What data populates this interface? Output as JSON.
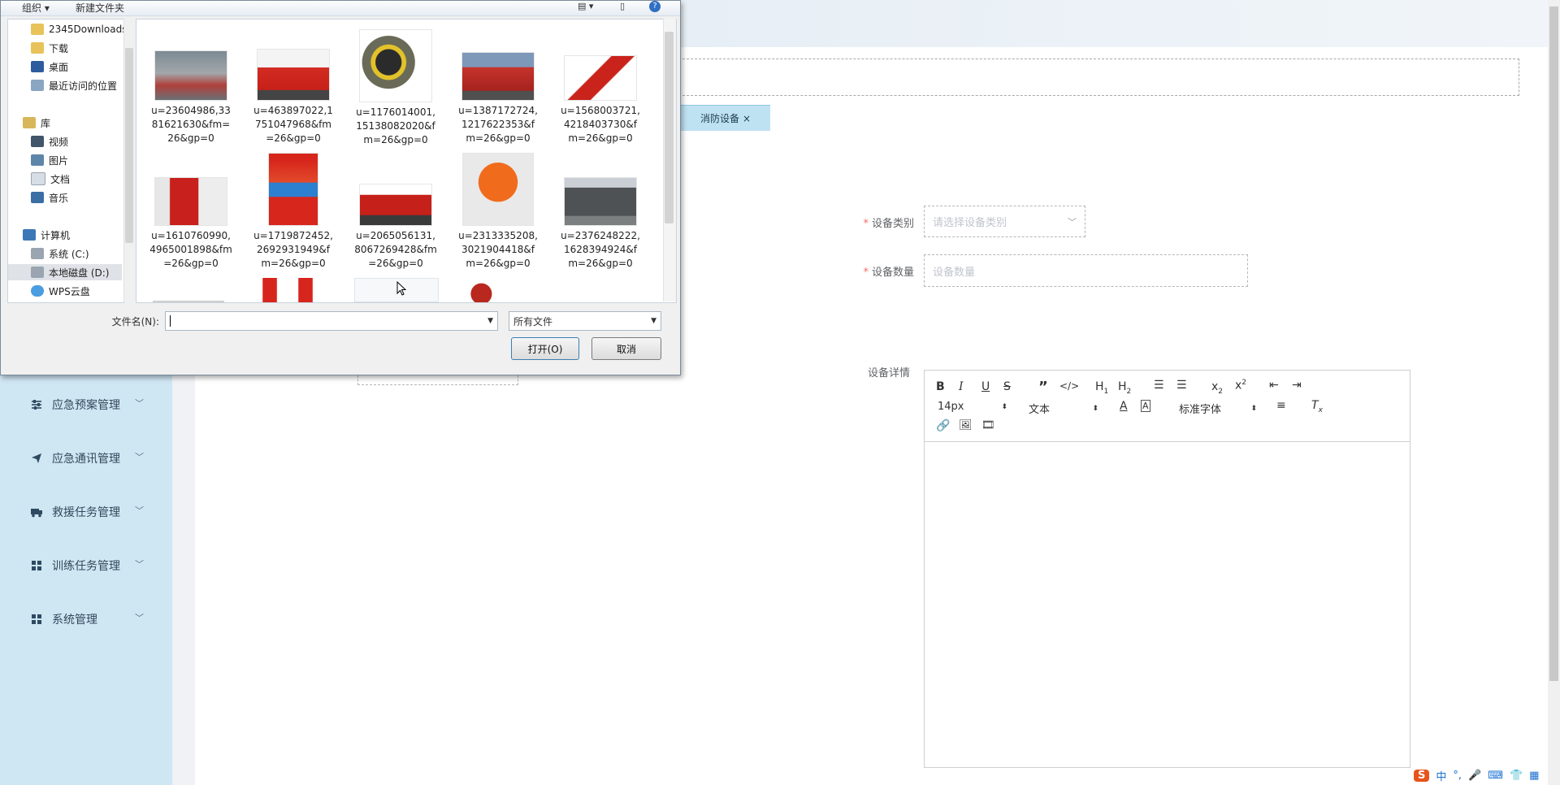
{
  "dialog": {
    "toolbar": {
      "organize_label": "组织 ▾",
      "new_folder_label": "新建文件夹"
    },
    "nav_items": [
      {
        "label": "2345Downloads",
        "icon": "folder-icon"
      },
      {
        "label": "下载",
        "icon": "download-folder-icon"
      },
      {
        "label": "桌面",
        "icon": "desktop-icon"
      },
      {
        "label": "最近访问的位置",
        "icon": "recent-icon"
      },
      {
        "label": "库",
        "icon": "library-icon"
      },
      {
        "label": "视频",
        "icon": "video-icon"
      },
      {
        "label": "图片",
        "icon": "pictures-icon"
      },
      {
        "label": "文档",
        "icon": "documents-icon"
      },
      {
        "label": "音乐",
        "icon": "music-icon"
      },
      {
        "label": "计算机",
        "icon": "computer-icon"
      },
      {
        "label": "系统 (C:)",
        "icon": "drive-icon"
      },
      {
        "label": "本地磁盘 (D:)",
        "icon": "drive-icon"
      },
      {
        "label": "WPS云盘",
        "icon": "cloud-icon"
      }
    ],
    "files": [
      {
        "name": "u=23604986,3381621630&fm=26&gp=0",
        "lines": [
          "u=23604986,33",
          "81621630&fm=",
          "26&gp=0"
        ]
      },
      {
        "name": "u=463897022,1751047968&fm=26&gp=0",
        "lines": [
          "u=463897022,1",
          "751047968&fm",
          "=26&gp=0"
        ]
      },
      {
        "name": "u=1176014001,15138082020&fm=26&gp=0",
        "lines": [
          "u=1176014001,",
          "15138082020&f",
          "m=26&gp=0"
        ]
      },
      {
        "name": "u=1387172724,1217622353&fm=26&gp=0",
        "lines": [
          "u=1387172724,",
          "1217622353&f",
          "m=26&gp=0"
        ]
      },
      {
        "name": "u=1568003721,4218403730&fm=26&gp=0",
        "lines": [
          "u=1568003721,",
          "4218403730&f",
          "m=26&gp=0"
        ]
      },
      {
        "name": "u=1610760990,4965001898&fm=26&gp=0",
        "lines": [
          "u=1610760990,",
          "4965001898&fm",
          "=26&gp=0"
        ]
      },
      {
        "name": "u=1719872452,2692931949&fm=26&gp=0",
        "lines": [
          "u=1719872452,",
          "2692931949&f",
          "m=26&gp=0"
        ]
      },
      {
        "name": "u=2065056131,8067269428&fm=26&gp=0",
        "lines": [
          "u=2065056131,",
          "8067269428&fm",
          "=26&gp=0"
        ]
      },
      {
        "name": "u=2313335208,3021904418&fm=26&gp=0",
        "lines": [
          "u=2313335208,",
          "3021904418&f",
          "m=26&gp=0"
        ]
      },
      {
        "name": "u=2376248222,1628394924&fm=26&gp=0",
        "lines": [
          "u=2376248222,",
          "1628394924&f",
          "m=26&gp=0"
        ]
      }
    ],
    "filename_label": "文件名(N):",
    "filename_value": "",
    "filetype_value": "所有文件",
    "open_label": "打开(O)",
    "cancel_label": "取消"
  },
  "app": {
    "tab_label": "消防设备",
    "sidebar_items": [
      {
        "label": "应急预案管理",
        "icon": "sliders-icon"
      },
      {
        "label": "应急通讯管理",
        "icon": "send-icon"
      },
      {
        "label": "救援任务管理",
        "icon": "truck-icon"
      },
      {
        "label": "训练任务管理",
        "icon": "grid-icon"
      },
      {
        "label": "系统管理",
        "icon": "grid-icon"
      }
    ],
    "form": {
      "category_label": "设备类别",
      "category_placeholder": "请选择设备类别",
      "quantity_label": "设备数量",
      "quantity_placeholder": "设备数量",
      "detail_label": "设备详情"
    },
    "editor": {
      "font_size": "14px",
      "block_type": "文本",
      "font_family": "标准字体"
    }
  },
  "colors": {
    "accent": "#bfe2f3",
    "sidebar_bg": "#cfe6f3",
    "required": "#f56c6c"
  }
}
